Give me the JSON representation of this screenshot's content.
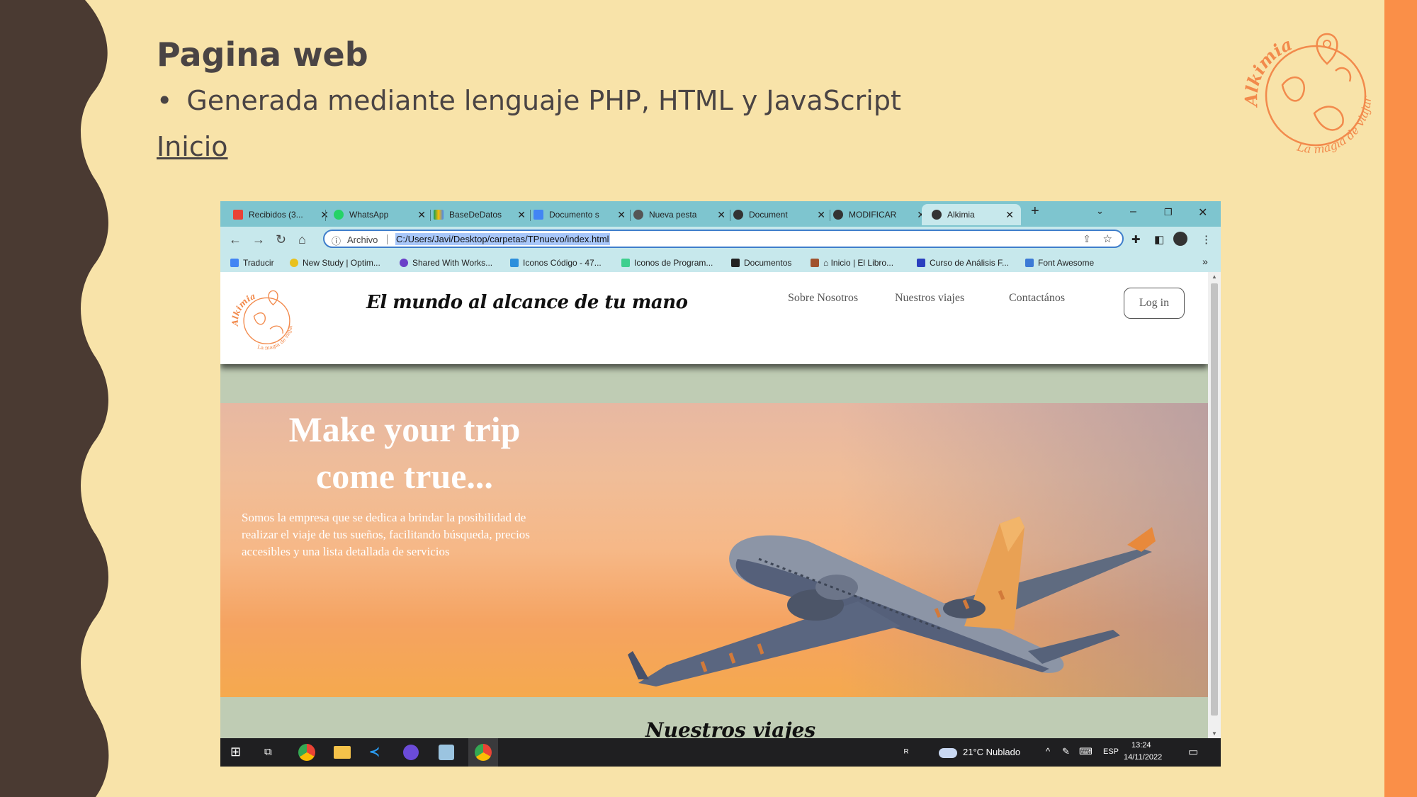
{
  "slide": {
    "title": "Pagina web",
    "bullet": "Generada mediante lenguaje PHP, HTML y JavaScript",
    "link": "Inicio",
    "logo_text_top": "Alkimia",
    "logo_text_bottom": "La magia de viajar"
  },
  "browser": {
    "tabs": [
      {
        "label": "Recibidos (3..."
      },
      {
        "label": "WhatsApp"
      },
      {
        "label": "BaseDeDatos"
      },
      {
        "label": "Documento s"
      },
      {
        "label": "Nueva pesta"
      },
      {
        "label": "Document"
      },
      {
        "label": "MODIFICAR"
      },
      {
        "label": "Alkimia"
      }
    ],
    "new_tab": "+",
    "address": {
      "scheme_label": "Archivo",
      "url": "C:/Users/Javi/Desktop/carpetas/TPnuevo/index.html"
    },
    "bookmarks": [
      {
        "label": "Traducir"
      },
      {
        "label": "New Study | Optim..."
      },
      {
        "label": "Shared With Works..."
      },
      {
        "label": "Iconos Código - 47..."
      },
      {
        "label": "Iconos de Program..."
      },
      {
        "label": "Documentos"
      },
      {
        "label": "Inicio | El Libro..."
      },
      {
        "label": "Curso de Análisis F..."
      },
      {
        "label": "Font Awesome"
      }
    ],
    "more": "»"
  },
  "site": {
    "logo_text_top": "Alkimia",
    "logo_text_bottom": "La magia de viajar",
    "tagline": "El mundo al alcance de tu mano",
    "nav": [
      {
        "label": "Sobre Nosotros"
      },
      {
        "label": "Nuestros viajes"
      },
      {
        "label": "Contactános"
      }
    ],
    "login": "Log in",
    "hero_title_line1": "Make your trip",
    "hero_title_line2": "come true...",
    "hero_text": "Somos la empresa que se dedica a brindar la posibilidad de realizar el viaje de tus sueños, facilitando búsqueda, precios accesibles y una lista detallada de servicios",
    "section_title": "Nuestros viajes"
  },
  "taskbar": {
    "weather": "21°C  Nublado",
    "lang": "ESP",
    "time": "13:24",
    "date": "14/11/2022"
  },
  "colors": {
    "background": "#f8e3a9",
    "accent": "#fa8f48",
    "dark": "#4a3a32",
    "tab_bar": "#7ec5cf"
  }
}
